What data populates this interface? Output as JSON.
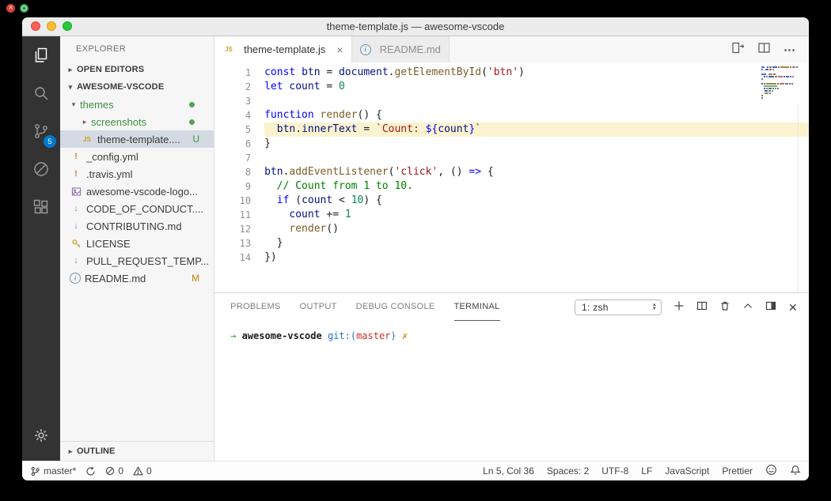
{
  "window": {
    "title": "theme-template.js — awesome-vscode"
  },
  "activity_bar": {
    "scm_badge": "5"
  },
  "sidebar": {
    "title": "EXPLORER",
    "open_editors_label": "OPEN EDITORS",
    "root_label": "AWESOME-VSCODE",
    "outline_label": "OUTLINE",
    "tree": [
      {
        "label": "themes",
        "kind": "folder",
        "expanded": true,
        "level": 0,
        "green": true,
        "dot": true
      },
      {
        "label": "screenshots",
        "kind": "folder",
        "expanded": false,
        "level": 1,
        "green": true,
        "dot": true
      },
      {
        "label": "theme-template....",
        "kind": "file",
        "icon": "js",
        "level": 1,
        "selected": true,
        "badge": "U"
      },
      {
        "label": "_config.yml",
        "kind": "file",
        "icon": "yml",
        "level": 0
      },
      {
        "label": ".travis.yml",
        "kind": "file",
        "icon": "yml",
        "level": 0
      },
      {
        "label": "awesome-vscode-logo...",
        "kind": "file",
        "icon": "image",
        "level": 0
      },
      {
        "label": "CODE_OF_CONDUCT....",
        "kind": "file",
        "icon": "md",
        "level": 0
      },
      {
        "label": "CONTRIBUTING.md",
        "kind": "file",
        "icon": "md",
        "level": 0
      },
      {
        "label": "LICENSE",
        "kind": "file",
        "icon": "license",
        "level": 0
      },
      {
        "label": "PULL_REQUEST_TEMP...",
        "kind": "file",
        "icon": "md",
        "level": 0
      },
      {
        "label": "README.md",
        "kind": "file",
        "icon": "info",
        "level": 0,
        "badge": "M"
      }
    ]
  },
  "editor": {
    "tabs": [
      {
        "label": "theme-template.js",
        "icon": "js",
        "active": true
      },
      {
        "label": "README.md",
        "icon": "info",
        "active": false
      }
    ],
    "lines": [
      {
        "n": "1",
        "toks": [
          [
            "k",
            "const"
          ],
          [
            "p",
            " "
          ],
          [
            "v",
            "btn"
          ],
          [
            "p",
            " = "
          ],
          [
            "v",
            "document"
          ],
          [
            "p",
            "."
          ],
          [
            "f",
            "getElementById"
          ],
          [
            "p",
            "("
          ],
          [
            "s",
            "'btn'"
          ],
          [
            "p",
            ")"
          ]
        ]
      },
      {
        "n": "2",
        "toks": [
          [
            "k",
            "let"
          ],
          [
            "p",
            " "
          ],
          [
            "v",
            "count"
          ],
          [
            "p",
            " = "
          ],
          [
            "n",
            "0"
          ]
        ]
      },
      {
        "n": "3",
        "toks": []
      },
      {
        "n": "4",
        "toks": [
          [
            "k",
            "function"
          ],
          [
            "p",
            " "
          ],
          [
            "f",
            "render"
          ],
          [
            "p",
            "() {"
          ]
        ]
      },
      {
        "n": "5",
        "active": true,
        "toks": [
          [
            "p",
            "  "
          ],
          [
            "v",
            "btn"
          ],
          [
            "p",
            "."
          ],
          [
            "v",
            "innerText"
          ],
          [
            "p",
            " = "
          ],
          [
            "s",
            "`Count: "
          ],
          [
            "k",
            "${"
          ],
          [
            "v",
            "count"
          ],
          [
            "k",
            "}"
          ],
          [
            "s",
            "`"
          ]
        ]
      },
      {
        "n": "6",
        "toks": [
          [
            "p",
            "}"
          ]
        ]
      },
      {
        "n": "7",
        "toks": []
      },
      {
        "n": "8",
        "toks": [
          [
            "v",
            "btn"
          ],
          [
            "p",
            "."
          ],
          [
            "f",
            "addEventListener"
          ],
          [
            "p",
            "("
          ],
          [
            "s",
            "'click'"
          ],
          [
            "p",
            ", () "
          ],
          [
            "k",
            "=>"
          ],
          [
            "p",
            " {"
          ]
        ]
      },
      {
        "n": "9",
        "toks": [
          [
            "p",
            "  "
          ],
          [
            "c",
            "// Count from 1 to 10."
          ]
        ]
      },
      {
        "n": "10",
        "toks": [
          [
            "p",
            "  "
          ],
          [
            "k",
            "if"
          ],
          [
            "p",
            " ("
          ],
          [
            "v",
            "count"
          ],
          [
            "p",
            " < "
          ],
          [
            "n",
            "10"
          ],
          [
            "p",
            ") {"
          ]
        ]
      },
      {
        "n": "11",
        "toks": [
          [
            "p",
            "    "
          ],
          [
            "v",
            "count"
          ],
          [
            "p",
            " += "
          ],
          [
            "n",
            "1"
          ]
        ]
      },
      {
        "n": "12",
        "toks": [
          [
            "p",
            "    "
          ],
          [
            "f",
            "render"
          ],
          [
            "p",
            "()"
          ]
        ]
      },
      {
        "n": "13",
        "toks": [
          [
            "p",
            "  }"
          ]
        ]
      },
      {
        "n": "14",
        "toks": [
          [
            "p",
            "})"
          ]
        ]
      }
    ]
  },
  "panel": {
    "tabs": [
      "PROBLEMS",
      "OUTPUT",
      "DEBUG CONSOLE",
      "TERMINAL"
    ],
    "active_tab": "TERMINAL",
    "shell_selector": "1: zsh",
    "terminal_line": [
      [
        "green",
        "→"
      ],
      [
        "plain",
        "  "
      ],
      [
        "cwd",
        "awesome-vscode"
      ],
      [
        "plain",
        " "
      ],
      [
        "blue",
        "git:("
      ],
      [
        "red",
        "master"
      ],
      [
        "blue",
        ")"
      ],
      [
        "plain",
        " "
      ],
      [
        "yellow",
        "✗"
      ]
    ]
  },
  "status_bar": {
    "branch": "master*",
    "errors": "0",
    "warnings": "0",
    "right": [
      "Ln 5, Col 36",
      "Spaces: 2",
      "UTF-8",
      "LF",
      "JavaScript",
      "Prettier"
    ]
  },
  "colors": {
    "accent": "#007acc",
    "git_green": "#3f8f3f",
    "git_modified": "#bf8803"
  }
}
